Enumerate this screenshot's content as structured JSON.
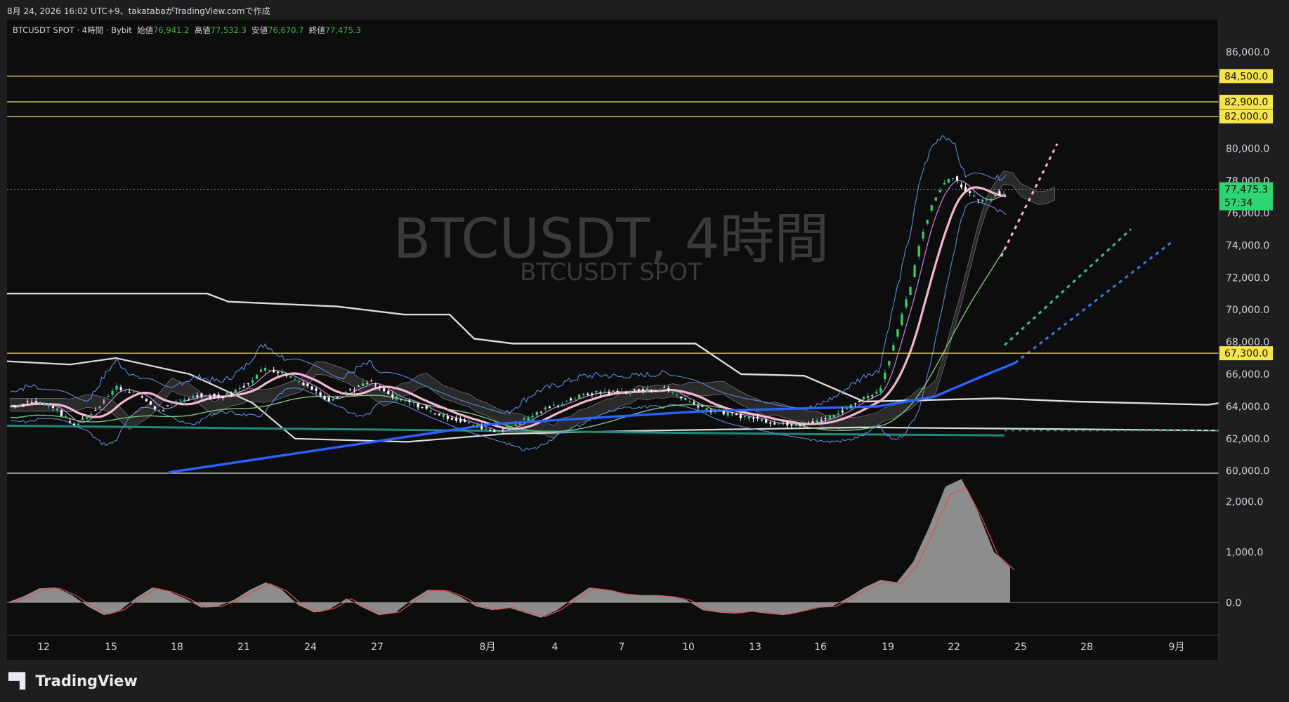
{
  "header": {
    "caption": "8月 24, 2026 16:02 UTC+9、takatabaがTradingView.comで作成"
  },
  "legend": {
    "symbol": "BTCUSDT SPOT · 4時間 · Bybit",
    "open_label": "始値",
    "open": "76,941.2",
    "high_label": "高値",
    "high": "77,532.3",
    "low_label": "安値",
    "low": "76,670.7",
    "close_label": "終値",
    "close": "77,475.3"
  },
  "watermark": {
    "title": "BTCUSDT, 4時間",
    "subtitle": "BTCUSDT SPOT"
  },
  "footer": {
    "brand": "TradingView"
  },
  "colors": {
    "background": "#0d0d0d",
    "up": "#26a69a",
    "down": "#ffffff",
    "level": "#e8d85c",
    "price_badge": "#2ed573",
    "sma_pink": "#f4b6cf",
    "sma_blue": "#2962ff",
    "sma_green": "#7bc47f",
    "band_blue": "#5b8bd9",
    "band_purple": "#c784e0",
    "white_line": "#dcdcdc"
  },
  "chart_data": [
    {
      "type": "candlestick",
      "title": "",
      "y_axis_ticks": [
        60000,
        62000,
        64000,
        66000,
        68000,
        70000,
        72000,
        74000,
        76000,
        78000,
        80000,
        86000
      ],
      "y_axis_tick_labels": [
        "60,000.0",
        "62,000.0",
        "64,000.0",
        "66,000.0",
        "68,000.0",
        "70,000.0",
        "72,000.0",
        "74,000.0",
        "76,000.0",
        "78,000.0",
        "80,000.0",
        "86,000.0"
      ],
      "ylim": [
        59900,
        88000
      ],
      "x_axis_tick_labels": [
        "12",
        "15",
        "18",
        "21",
        "24",
        "27",
        "8月",
        "4",
        "7",
        "10",
        "13",
        "16",
        "19",
        "22",
        "25",
        "28",
        "9月"
      ],
      "horizontal_levels": [
        {
          "value": 84500,
          "label": "84,500.0"
        },
        {
          "value": 82900,
          "label": "82,900.0"
        },
        {
          "value": 82000,
          "label": "82,000.0"
        },
        {
          "value": 67300,
          "label": "67,300.0"
        }
      ],
      "last_price": {
        "value": 77475.3,
        "label": "77,475.3",
        "countdown": "57:34"
      },
      "price_path": [
        [
          0,
          64000
        ],
        [
          2,
          64300
        ],
        [
          4,
          64000
        ],
        [
          6,
          62800
        ],
        [
          8,
          63800
        ],
        [
          10,
          65200
        ],
        [
          12,
          64800
        ],
        [
          14,
          63700
        ],
        [
          16,
          64400
        ],
        [
          18,
          64700
        ],
        [
          20,
          64600
        ],
        [
          22,
          65200
        ],
        [
          24,
          66400
        ],
        [
          26,
          66000
        ],
        [
          28,
          65300
        ],
        [
          30,
          64400
        ],
        [
          32,
          65000
        ],
        [
          34,
          65500
        ],
        [
          36,
          64600
        ],
        [
          38,
          64200
        ],
        [
          40,
          63600
        ],
        [
          42,
          63200
        ],
        [
          44,
          62800
        ],
        [
          46,
          62400
        ],
        [
          48,
          63000
        ],
        [
          50,
          63700
        ],
        [
          52,
          64200
        ],
        [
          54,
          64700
        ],
        [
          56,
          64900
        ],
        [
          58,
          64900
        ],
        [
          60,
          65000
        ],
        [
          62,
          65100
        ],
        [
          64,
          64300
        ],
        [
          66,
          63800
        ],
        [
          68,
          63500
        ],
        [
          70,
          63300
        ],
        [
          72,
          63000
        ],
        [
          74,
          62900
        ],
        [
          76,
          63000
        ],
        [
          78,
          63500
        ],
        [
          80,
          64300
        ],
        [
          81,
          64700
        ],
        [
          82,
          64900
        ],
        [
          83,
          67000
        ],
        [
          84,
          69200
        ],
        [
          85,
          71500
        ],
        [
          86,
          74500
        ],
        [
          87,
          76500
        ],
        [
          88,
          77800
        ],
        [
          89,
          78300
        ],
        [
          90,
          77500
        ],
        [
          91,
          77000
        ],
        [
          92,
          76700
        ],
        [
          93,
          77200
        ],
        [
          94,
          77300
        ]
      ],
      "projected_lines": [
        {
          "color": "pink dotted",
          "from": [
            73300
          ],
          "to": [
            80300
          ]
        },
        {
          "color": "green dotted",
          "to": [
            75000
          ]
        },
        {
          "color": "blue dotted",
          "to": [
            74200
          ]
        }
      ]
    },
    {
      "type": "area",
      "title": "",
      "y_axis_ticks": [
        0,
        1000,
        2000
      ],
      "y_axis_tick_labels": [
        "0.0",
        "1,000.0",
        "2,000.0"
      ],
      "ylim": [
        -650,
        2550
      ],
      "series": [
        {
          "values": [
            0,
            120,
            280,
            300,
            150,
            -80,
            -250,
            -150,
            100,
            300,
            220,
            80,
            -100,
            -80,
            50,
            250,
            400,
            250,
            -50,
            -200,
            -120,
            80,
            -100,
            -250,
            -200,
            50,
            250,
            250,
            120,
            -80,
            -150,
            -100,
            -200,
            -300,
            -150,
            80,
            300,
            260,
            180,
            150,
            150,
            120,
            50,
            -150,
            -200,
            -220,
            -180,
            -220,
            -250,
            -180,
            -100,
            -80,
            100,
            300,
            450,
            400,
            800,
            1500,
            2300,
            2450,
            1800,
            1000,
            700
          ]
        }
      ]
    }
  ]
}
